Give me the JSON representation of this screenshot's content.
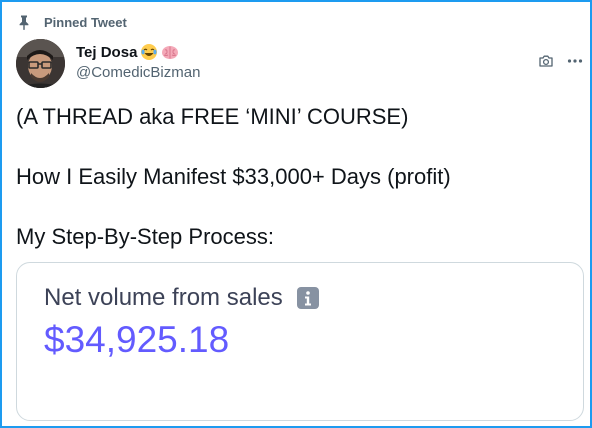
{
  "pinned_label": "Pinned Tweet",
  "author": {
    "name": "Tej Dosa",
    "handle": "@ComedicBizman",
    "name_emojis": [
      "laughing-tears-emoji",
      "brain-emoji"
    ]
  },
  "tweet": {
    "line1": "(A THREAD aka FREE ‘MINI’ COURSE)",
    "line2": "How I Easily Manifest $33,000+ Days (profit)",
    "line3": "My Step-By-Step Process:"
  },
  "card": {
    "title": "Net volume from sales",
    "amount": "$34,925.18",
    "amount_color": "#635bff"
  },
  "icons": [
    "pin-icon",
    "camera-icon",
    "more-icon",
    "info-icon"
  ],
  "colors": {
    "accent_border": "#1d9bf0",
    "secondary_text": "#536471",
    "primary_text": "#0f1419"
  }
}
